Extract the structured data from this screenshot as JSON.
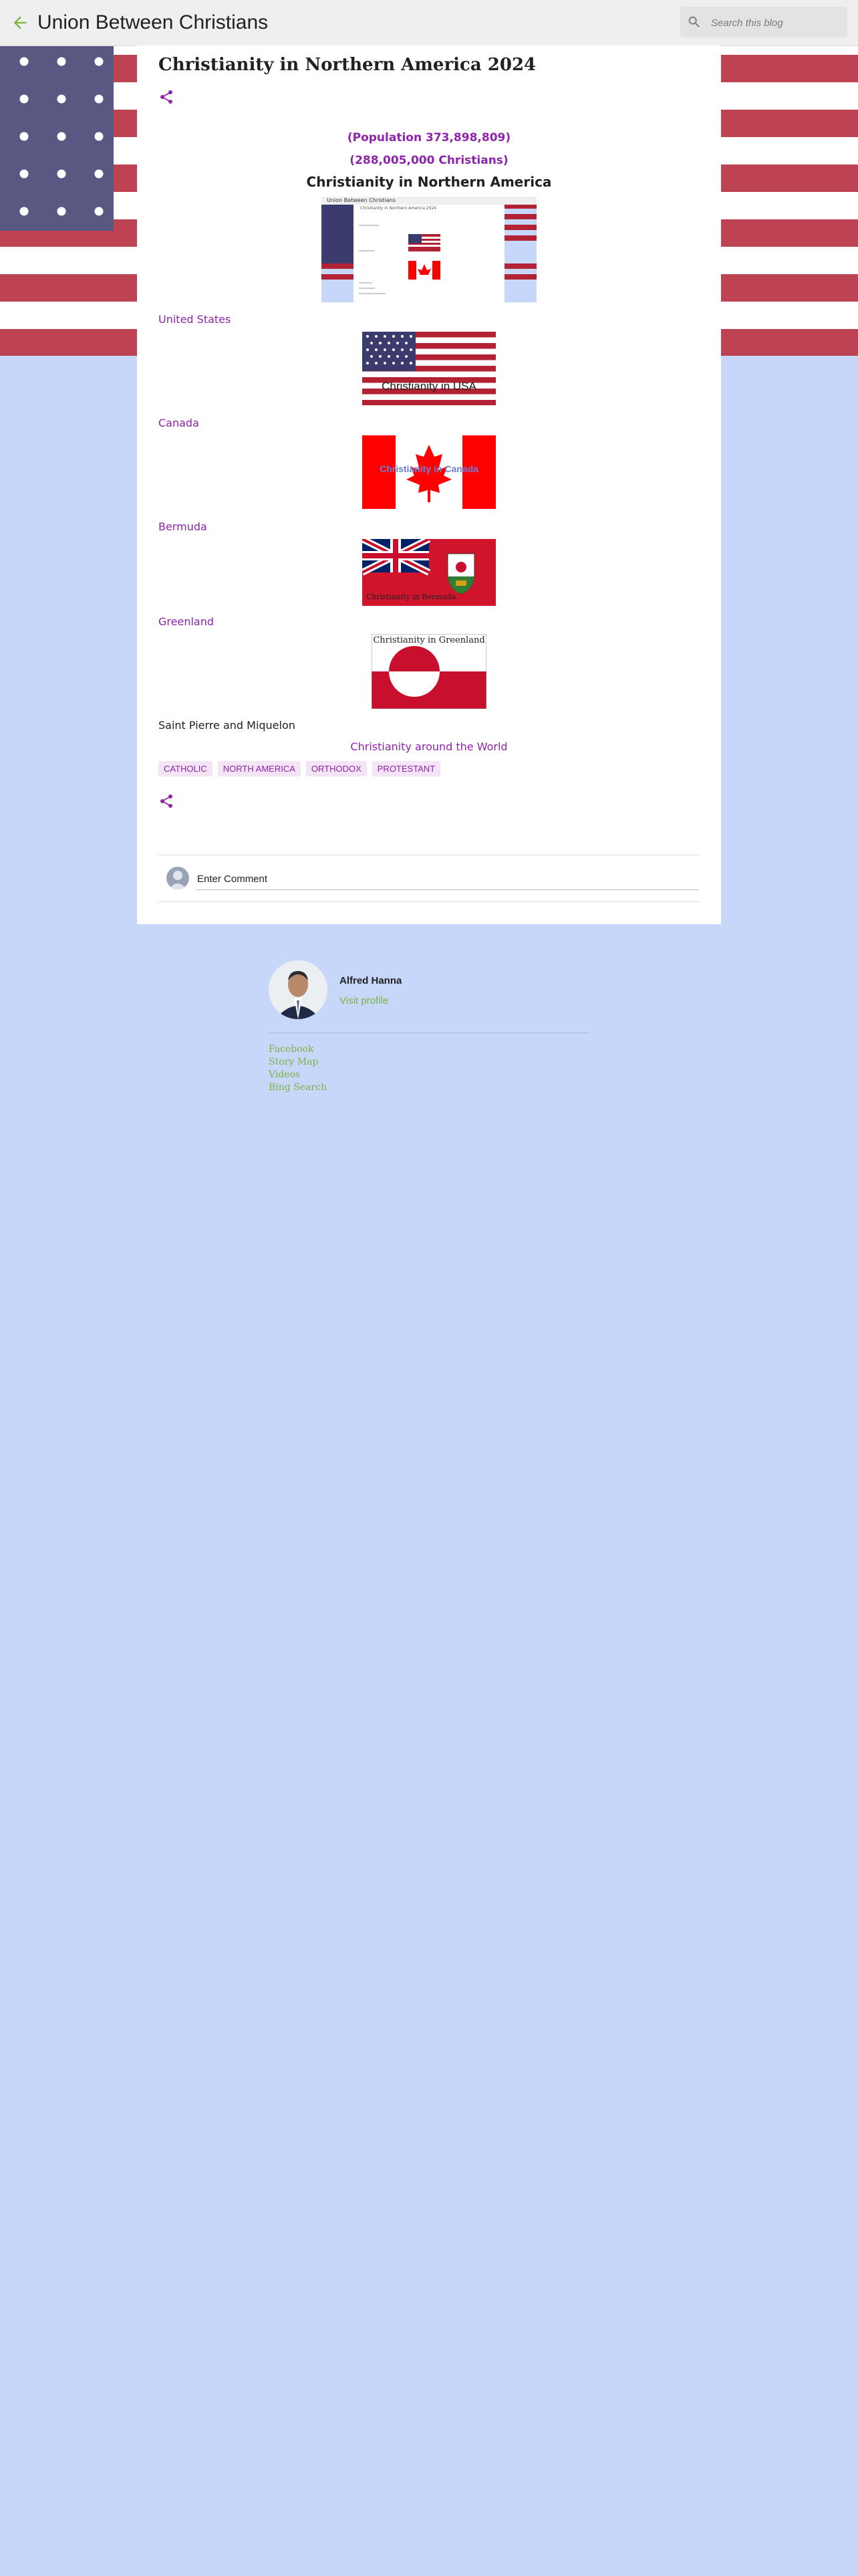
{
  "header": {
    "blog_title": "Union Between Christians",
    "search_placeholder": "Search this blog"
  },
  "post": {
    "title": "Christianity in Northern America 2024",
    "population": "(Population 373,898,809)",
    "christians": "(288,005,000 Christians)",
    "region_heading": "Christianity in Northern America",
    "overview_image": {
      "window_title": "Union Between Christians",
      "heading": "Christianity in Northern America 2024"
    },
    "countries": [
      {
        "name": "United States",
        "flag_caption": "Christianity in USA"
      },
      {
        "name": "Canada",
        "flag_caption": "Christianity in Canada"
      },
      {
        "name": "Bermuda",
        "flag_caption": "Christianity in Bermuda"
      },
      {
        "name": "Greenland",
        "flag_caption": "Christianity in Greenland"
      }
    ],
    "saint_pierre": "Saint Pierre and Miquelon",
    "world_link": "Christianity around the World",
    "labels": [
      "CATHOLIC",
      "NORTH AMERICA",
      "ORTHODOX",
      "PROTESTANT"
    ]
  },
  "comments": {
    "placeholder": "Enter Comment"
  },
  "profile": {
    "name": "Alfred Hanna",
    "visit_label": "Visit profile"
  },
  "links": [
    "Facebook",
    "Story Map",
    "Videos",
    "Bing Search"
  ],
  "colors": {
    "accent_purple": "#8e24aa",
    "link_green": "#7cb342",
    "page_background": "#c6d7fa",
    "flag_red": "#b22234",
    "flag_blue": "#3c3b6e"
  }
}
